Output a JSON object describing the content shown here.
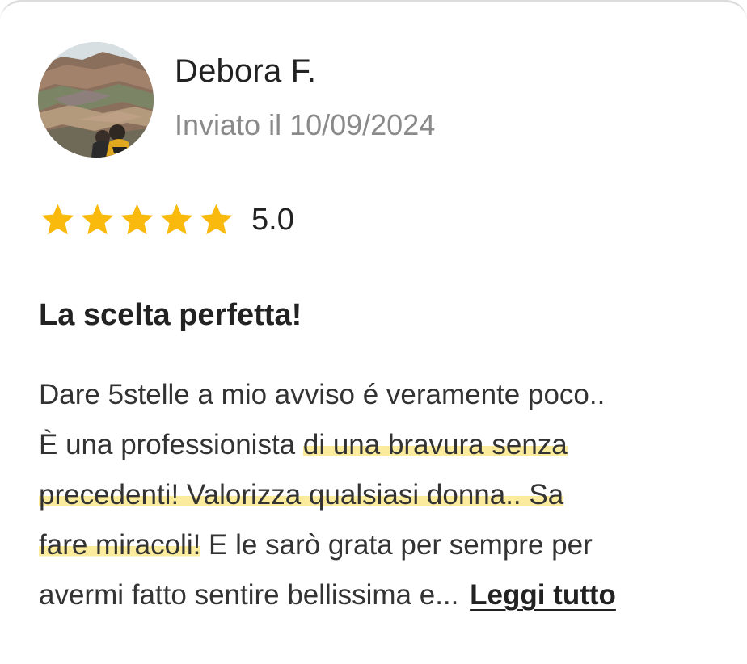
{
  "review": {
    "author": "Debora F.",
    "date": "Inviato il 10/09/2024",
    "rating": 5,
    "rating_label": "5.0",
    "star_color": "#f9b90d",
    "highlight_color": "#fbeb9c",
    "title": "La scelta perfetta!",
    "text": {
      "line1": "Dare 5stelle a mio avviso é veramente poco..",
      "line2_a": "È una professionista ",
      "line2_b": "di una bravura senza",
      "line3": "precedenti! Valorizza qualsiasi donna.. Sa",
      "line4_a": "fare miracoli!",
      "line4_b": " E le sarò grata per sempre per",
      "line5": "avermi fatto sentire bellissima e..."
    },
    "read_more": "Leggi tutto",
    "avatar_icon": "profile-photo-mountain"
  }
}
